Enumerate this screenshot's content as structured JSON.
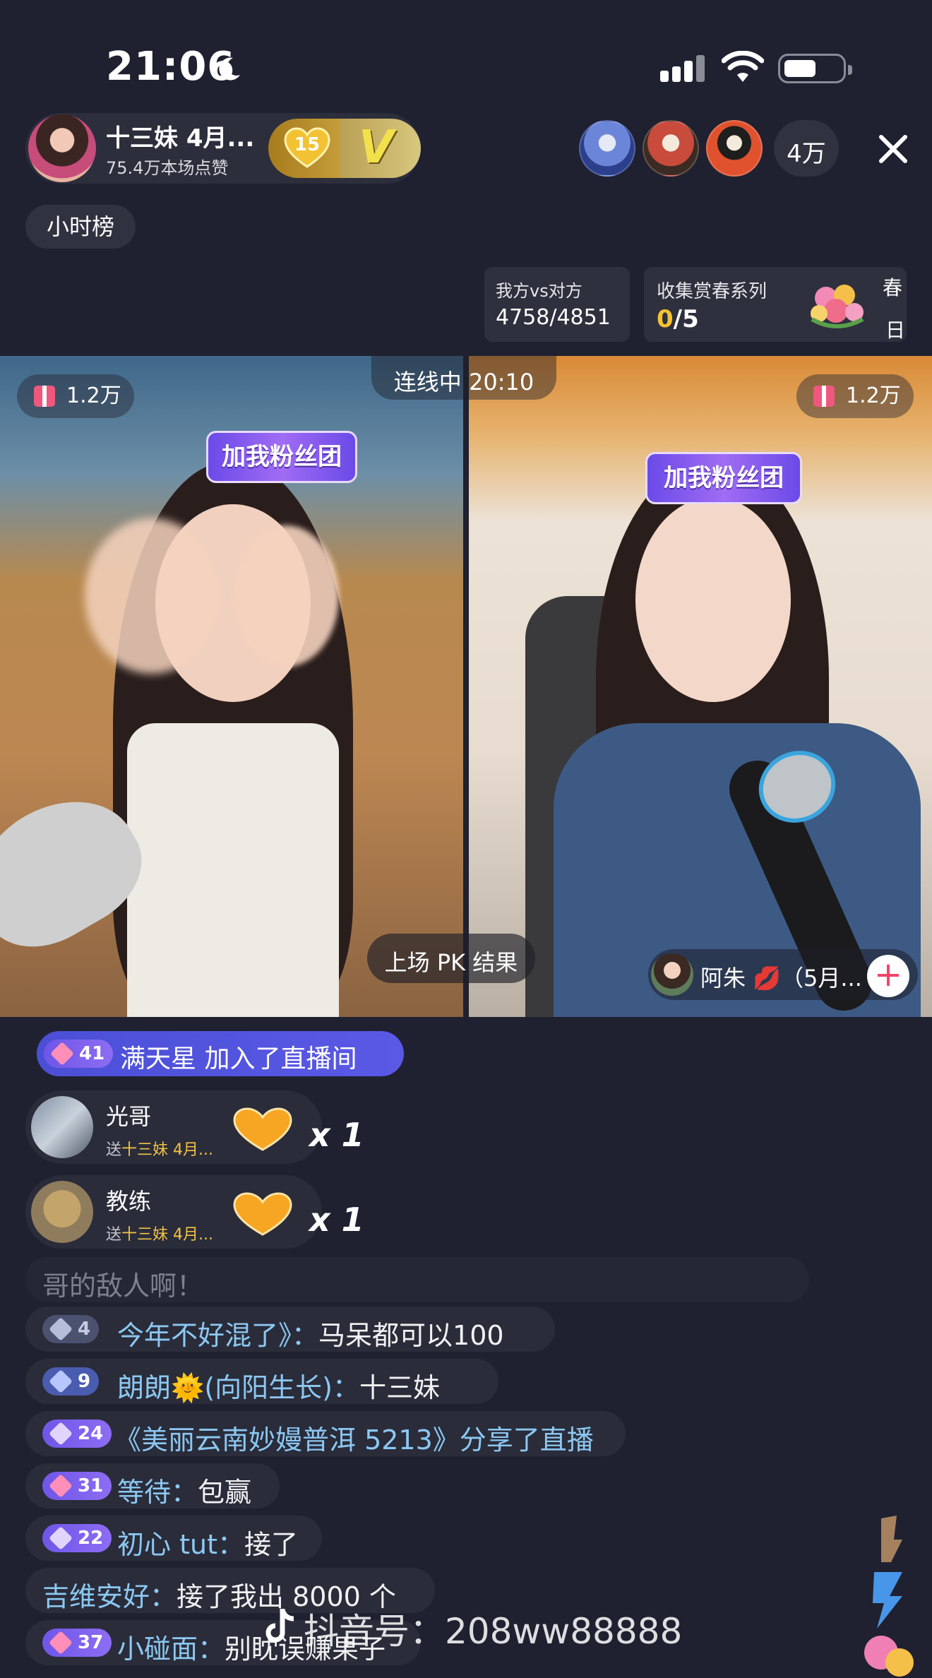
{
  "status_bar": {
    "time": "21:06"
  },
  "header": {
    "host_name": "十三妹 4月...",
    "host_likes": "75.4万本场点赞",
    "fan_level": "15",
    "vip_letter": "V",
    "viewer_count": "4万",
    "hour_rank": "小时榜"
  },
  "pk": {
    "score_label": "我方vs对方",
    "score_value": "4758/4851",
    "collect_title": "收集赏春系列",
    "collect_current": "0",
    "collect_total": "/5",
    "collect_side_1": "春",
    "collect_side_2": "日",
    "link_timer": "连线中 20:10",
    "gift_left": "1.2万",
    "gift_right": "1.2万",
    "sticker_text": "加我粉丝团",
    "pk_result": "上场 PK 结果",
    "opponent_name": "阿朱 💋（5月...",
    "follow_plus": "+"
  },
  "chat": {
    "join": {
      "level": "41",
      "text": "满天星 加入了直播间"
    },
    "gifts": [
      {
        "user": "光哥",
        "prefix": "送",
        "target": "十三妹 4月...",
        "count": "x 1"
      },
      {
        "user": "教练",
        "prefix": "送",
        "target": "十三妹 4月...",
        "count": "x 1"
      }
    ],
    "faded": "哥的敌人啊！",
    "messages": [
      {
        "level": "4",
        "user": "今年不好混了》：",
        "text": "马呆都可以100"
      },
      {
        "level": "9",
        "user": "朗朗🌞(向阳生长)：",
        "text": "十三妹"
      },
      {
        "level": "24",
        "user": "《美丽云南妙嫚普洱 5213》分享了直播",
        "text": ""
      },
      {
        "level": "31",
        "user": "等待：",
        "text": "包赢"
      },
      {
        "level": "22",
        "user": "初心 tut：",
        "text": "接了"
      },
      {
        "level": "",
        "user": "吉维安好：",
        "text": "接了我出 8000 个"
      },
      {
        "level": "37",
        "user": "小碰面：",
        "text": "别眈误赚果子"
      }
    ]
  },
  "watermark": "抖音号：208ww88888",
  "colors": {
    "background": "#1f2130",
    "accent_yellow": "#f5c331",
    "join_purple": "#4b4fd6",
    "chat_user_blue": "#8cc8f2"
  }
}
